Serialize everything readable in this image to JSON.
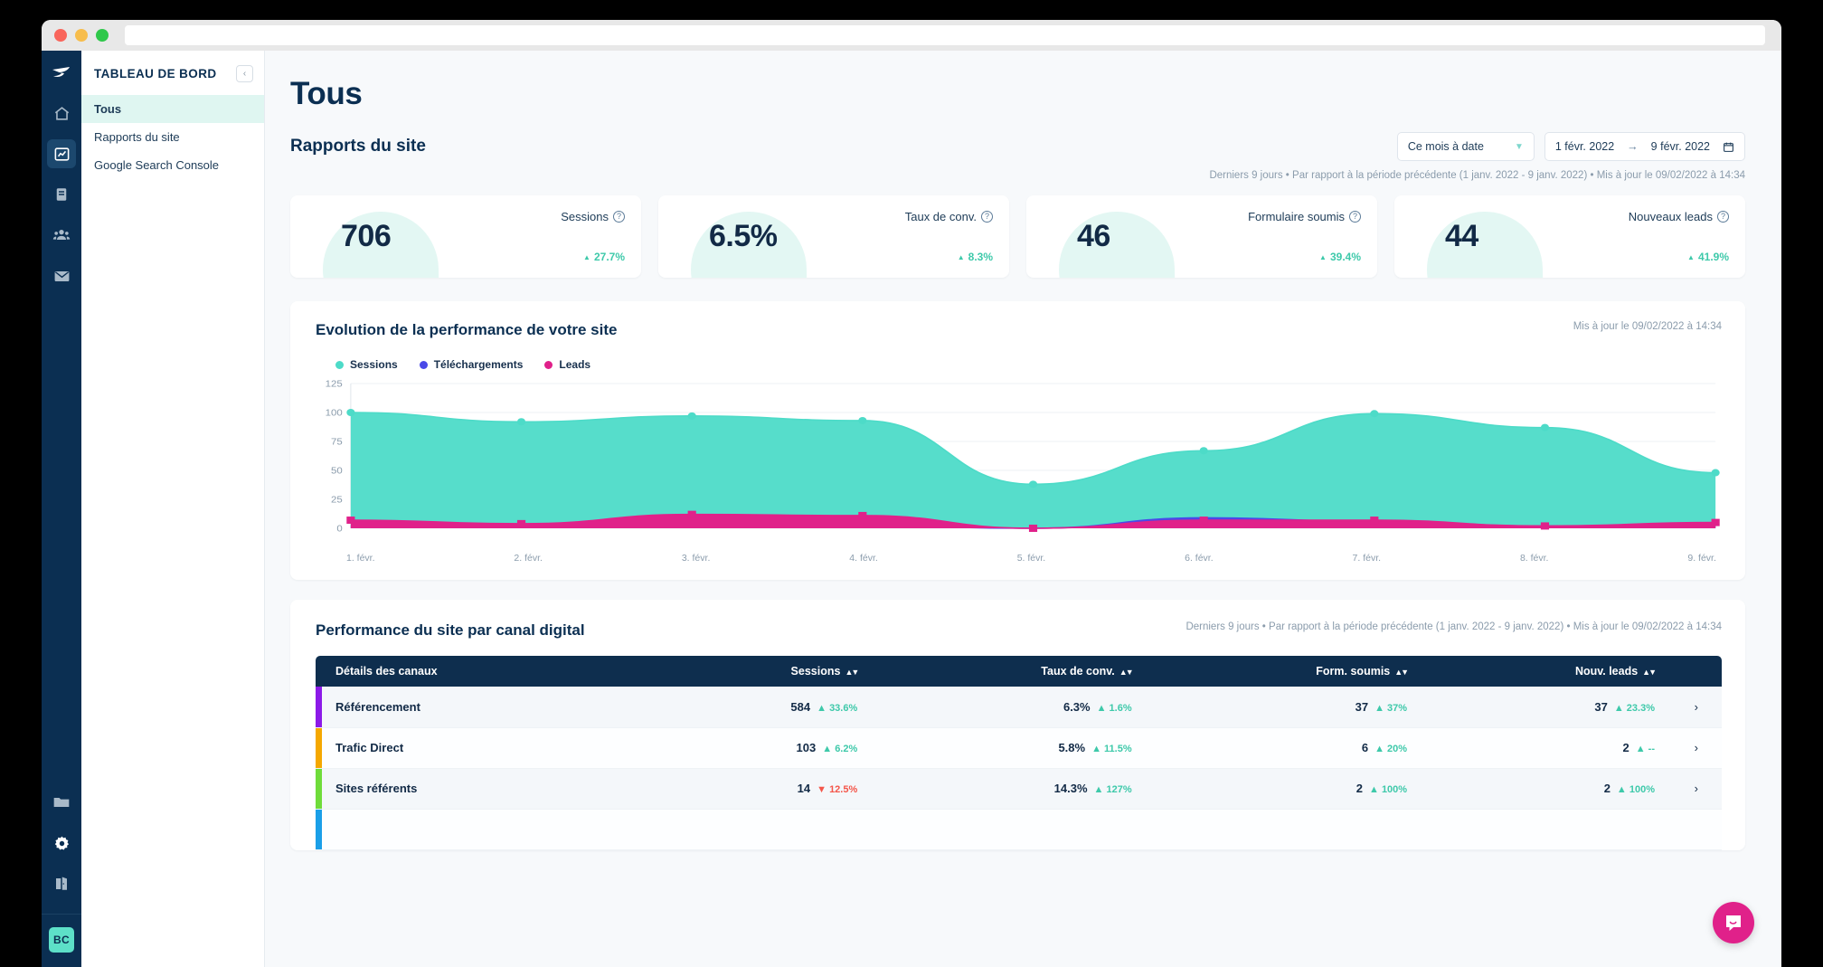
{
  "window": {
    "url_value": "",
    "url_placeholder": ""
  },
  "rail": {
    "logo": "brand-logo",
    "icons": [
      {
        "name": "home-icon",
        "active": false
      },
      {
        "name": "analytics-chart-icon",
        "active": true
      },
      {
        "name": "book-icon",
        "active": false
      },
      {
        "name": "contacts-icon",
        "active": false
      },
      {
        "name": "email-icon",
        "active": false
      }
    ],
    "bottom_icons": [
      {
        "name": "folder-icon"
      },
      {
        "name": "gear-icon"
      },
      {
        "name": "exit-door-icon"
      }
    ],
    "avatar_initials": "BC"
  },
  "nav": {
    "title": "TABLEAU DE BORD",
    "collapse_label": "‹",
    "items": [
      {
        "label": "Tous",
        "active": true
      },
      {
        "label": "Rapports du site",
        "active": false
      },
      {
        "label": "Google Search Console",
        "active": false
      }
    ]
  },
  "header": {
    "page_title": "Tous",
    "section_title": "Rapports du site",
    "period_select": "Ce mois à date",
    "date_start": "1 févr. 2022",
    "date_arrow": "→",
    "date_end": "9 févr. 2022",
    "meta": "Derniers 9 jours • Par rapport à la période précédente (1 janv. 2022 - 9 janv. 2022) • Mis à jour le 09/02/2022 à 14:34"
  },
  "kpis": [
    {
      "value": "706",
      "label": "Sessions",
      "delta": "27.7%",
      "dir": "up"
    },
    {
      "value": "6.5%",
      "label": "Taux de conv.",
      "delta": "8.3%",
      "dir": "up"
    },
    {
      "value": "46",
      "label": "Formulaire soumis",
      "delta": "39.4%",
      "dir": "up"
    },
    {
      "value": "44",
      "label": "Nouveaux leads",
      "delta": "41.9%",
      "dir": "up"
    }
  ],
  "chart_card": {
    "title": "Evolution de la performance de votre site",
    "meta": "Mis à jour le 09/02/2022 à 14:34"
  },
  "chart_data": {
    "type": "area",
    "title": "Evolution de la performance de votre site",
    "xlabel": "",
    "ylabel": "",
    "x": [
      "1. févr.",
      "2. févr.",
      "3. févr.",
      "4. févr.",
      "5. févr.",
      "6. févr.",
      "7. févr.",
      "8. févr.",
      "9. févr."
    ],
    "ylim": [
      0,
      125
    ],
    "yticks": [
      0,
      25,
      50,
      75,
      100,
      125
    ],
    "grid": true,
    "legend_position": "top-left",
    "series": [
      {
        "name": "Sessions",
        "color": "#4ddbc8",
        "values": [
          100,
          92,
          97,
          93,
          38,
          67,
          99,
          87,
          48
        ]
      },
      {
        "name": "Téléchargements",
        "color": "#4a49e8",
        "values": [
          2,
          1,
          2,
          2,
          0,
          9,
          6,
          2,
          2
        ]
      },
      {
        "name": "Leads",
        "color": "#e0218a",
        "values": [
          7,
          4,
          12,
          11,
          0,
          7,
          7,
          2,
          5
        ]
      }
    ]
  },
  "table_card": {
    "title": "Performance du site par canal digital",
    "meta": "Derniers 9 jours • Par rapport à la période précédente (1 janv. 2022 - 9 janv. 2022) • Mis à jour le 09/02/2022 à 14:34",
    "columns": [
      {
        "label": "Détails des canaux",
        "sortable": false
      },
      {
        "label": "Sessions",
        "sortable": true
      },
      {
        "label": "Taux de conv.",
        "sortable": true
      },
      {
        "label": "Form. soumis",
        "sortable": true
      },
      {
        "label": "Nouv. leads",
        "sortable": true
      }
    ],
    "rows": [
      {
        "color": "#8c1ae8",
        "name": "Référencement",
        "sessions": "584",
        "sessions_delta": "33.6%",
        "sessions_dir": "up",
        "conv": "6.3%",
        "conv_delta": "1.6%",
        "conv_dir": "up",
        "forms": "37",
        "forms_delta": "37%",
        "forms_dir": "up",
        "leads": "37",
        "leads_delta": "23.3%",
        "leads_dir": "up",
        "chevron": "›"
      },
      {
        "color": "#f5a800",
        "name": "Trafic Direct",
        "sessions": "103",
        "sessions_delta": "6.2%",
        "sessions_dir": "up",
        "conv": "5.8%",
        "conv_delta": "11.5%",
        "conv_dir": "up",
        "forms": "6",
        "forms_delta": "20%",
        "forms_dir": "up",
        "leads": "2",
        "leads_delta": "--",
        "leads_dir": "up",
        "chevron": "›"
      },
      {
        "color": "#6fdc3a",
        "name": "Sites référents",
        "sessions": "14",
        "sessions_delta": "12.5%",
        "sessions_dir": "down",
        "conv": "14.3%",
        "conv_delta": "127%",
        "conv_dir": "up",
        "forms": "2",
        "forms_delta": "100%",
        "forms_dir": "up",
        "leads": "2",
        "leads_delta": "100%",
        "leads_dir": "up",
        "chevron": "›"
      },
      {
        "color": "#1a9fe8",
        "name": "",
        "sessions": "",
        "sessions_delta": "",
        "sessions_dir": "up",
        "conv": "",
        "conv_delta": "",
        "conv_dir": "up",
        "forms": "",
        "forms_delta": "",
        "forms_dir": "up",
        "leads": "",
        "leads_delta": "",
        "leads_dir": "up",
        "chevron": ""
      }
    ]
  },
  "intercom": {
    "name": "intercom-chat-button"
  },
  "colors": {
    "brand_navy": "#0b2f52",
    "accent_teal": "#4ddbc8",
    "accent_pink": "#e0218a",
    "accent_blue": "#4a49e8",
    "positive": "#3ec9aa",
    "negative": "#f4564a"
  }
}
